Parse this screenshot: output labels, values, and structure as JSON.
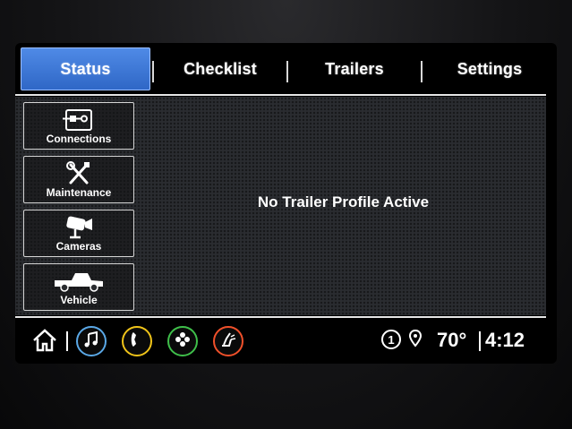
{
  "tabs": [
    {
      "label": "Status",
      "active": true
    },
    {
      "label": "Checklist",
      "active": false
    },
    {
      "label": "Trailers",
      "active": false
    },
    {
      "label": "Settings",
      "active": false
    }
  ],
  "sidebar": {
    "items": [
      {
        "label": "Connections",
        "icon": "connections-icon"
      },
      {
        "label": "Maintenance",
        "icon": "wrench-screwdriver-icon"
      },
      {
        "label": "Cameras",
        "icon": "camera-icon"
      },
      {
        "label": "Vehicle",
        "icon": "pickup-truck-icon"
      }
    ]
  },
  "main": {
    "message": "No Trailer Profile Active"
  },
  "status_bar": {
    "apps": [
      {
        "icon": "home-icon"
      },
      {
        "icon": "music-icon",
        "ring_color": "#5aa8e6"
      },
      {
        "icon": "phone-icon",
        "ring_color": "#f0c419"
      },
      {
        "icon": "apps-icon",
        "ring_color": "#3fbf4a"
      },
      {
        "icon": "climate-seat-icon",
        "ring_color": "#f0502a"
      }
    ],
    "notification_count": "1",
    "temperature": "70°",
    "time": "4:12"
  },
  "colors": {
    "active_tab": "#3a74d6",
    "content_bg": "#2a2c30"
  }
}
